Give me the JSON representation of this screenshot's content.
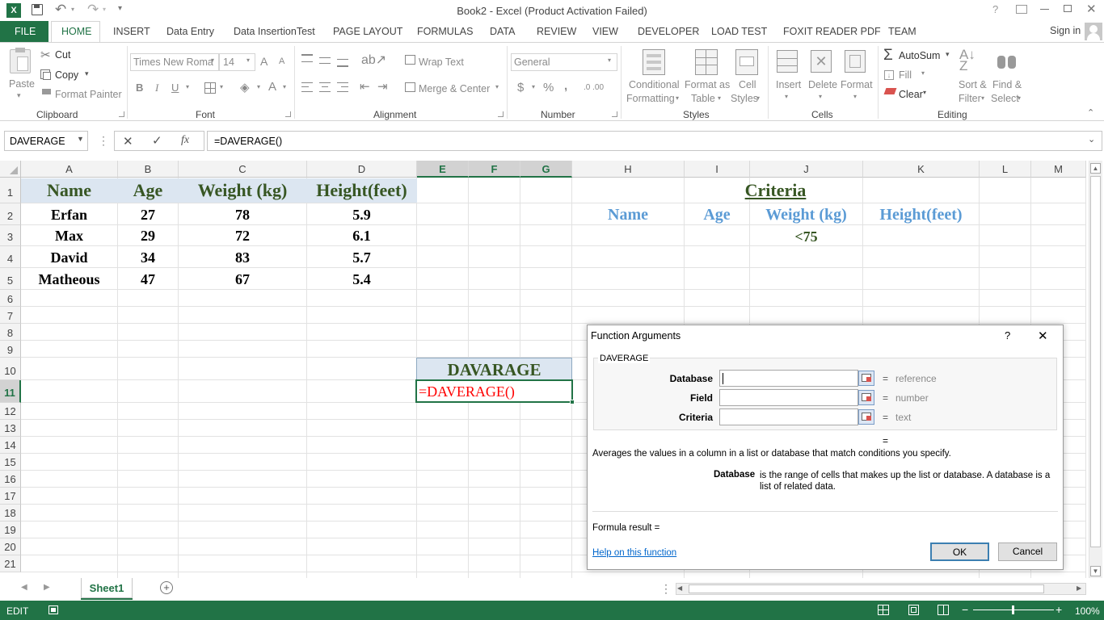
{
  "window": {
    "title": "Book2 - Excel (Product Activation Failed)",
    "excel_icon": "excel-logo-icon",
    "help_label": "?",
    "signin": "Sign in"
  },
  "ribbon_tabs": [
    "FILE",
    "HOME",
    "INSERT",
    "Data Entry",
    "Data InsertionTest",
    "PAGE LAYOUT",
    "FORMULAS",
    "DATA",
    "REVIEW",
    "VIEW",
    "DEVELOPER",
    "LOAD TEST",
    "FOXIT READER PDF",
    "TEAM"
  ],
  "ribbon": {
    "clipboard": {
      "paste": "Paste",
      "cut": "Cut",
      "copy": "Copy",
      "format_painter": "Format Painter",
      "label": "Clipboard"
    },
    "font": {
      "name": "Times New Roma",
      "size": "14",
      "bold": "B",
      "italic": "I",
      "underline": "U",
      "grow": "A",
      "shrink": "A",
      "color": "A",
      "label": "Font"
    },
    "alignment": {
      "wrap": "Wrap Text",
      "merge": "Merge & Center",
      "label": "Alignment"
    },
    "number": {
      "format": "General",
      "currency": "$",
      "percent": "%",
      "comma": ",",
      "inc": ".0 .00",
      "label": "Number"
    },
    "styles": {
      "conditional_1": "Conditional",
      "conditional_2": "Formatting",
      "format_table_1": "Format as",
      "format_table_2": "Table",
      "cell_styles_1": "Cell",
      "cell_styles_2": "Styles",
      "label": "Styles"
    },
    "cells": {
      "insert": "Insert",
      "delete": "Delete",
      "format": "Format",
      "label": "Cells"
    },
    "editing": {
      "autosum": "AutoSum",
      "fill": "Fill",
      "clear": "Clear",
      "sort_1": "Sort &",
      "sort_2": "Filter",
      "find_1": "Find &",
      "find_2": "Select",
      "label": "Editing"
    }
  },
  "formula_bar": {
    "name_box": "DAVERAGE",
    "cancel": "✕",
    "enter": "✓",
    "fx": "fx",
    "formula": "=DAVERAGE()"
  },
  "columns": [
    "A",
    "B",
    "C",
    "D",
    "E",
    "F",
    "G",
    "H",
    "I",
    "J",
    "K",
    "L",
    "M"
  ],
  "rows": [
    "1",
    "2",
    "3",
    "4",
    "5",
    "6",
    "7",
    "8",
    "9",
    "10",
    "11",
    "12",
    "13",
    "14",
    "15",
    "16",
    "17",
    "18",
    "19",
    "20",
    "21"
  ],
  "table": {
    "headers": [
      "Name",
      "Age",
      "Weight (kg)",
      "Height(feet)"
    ],
    "rows": [
      [
        "Erfan",
        "27",
        "78",
        "5.9"
      ],
      [
        "Max",
        "29",
        "72",
        "6.1"
      ],
      [
        "David",
        "34",
        "83",
        "5.7"
      ],
      [
        "Matheous",
        "47",
        "67",
        "5.4"
      ]
    ]
  },
  "criteria": {
    "title": "Criteria",
    "headers": [
      "Name",
      "Age",
      "Weight (kg)",
      "Height(feet)"
    ],
    "weight_condition": "<75"
  },
  "davarage": {
    "label": "DAVARAGE",
    "formula": "=DAVERAGE()"
  },
  "dialog": {
    "title": "Function Arguments",
    "help": "?",
    "close": "✕",
    "function_name": "DAVERAGE",
    "args": [
      {
        "label": "Database",
        "value": "",
        "hint": "reference"
      },
      {
        "label": "Field",
        "value": "",
        "hint": "number"
      },
      {
        "label": "Criteria",
        "value": "",
        "hint": "text"
      }
    ],
    "eq": "=",
    "description": "Averages the values in a column in a list or database that match conditions you specify.",
    "arg_name": "Database",
    "arg_desc": "is the range of cells that makes up the list or database. A database is a list of related data.",
    "formula_result": "Formula result =",
    "help_link": "Help on this function",
    "ok": "OK",
    "cancel": "Cancel"
  },
  "sheetbar": {
    "sheet": "Sheet1",
    "add": "+"
  },
  "status": {
    "mode": "EDIT",
    "zoom": "100%"
  },
  "colors": {
    "excel_green": "#217346",
    "header_green": "#375623",
    "criteria_blue": "#5b9bd5",
    "header_fill": "#dce6f1",
    "formula_red": "#ff0000"
  }
}
